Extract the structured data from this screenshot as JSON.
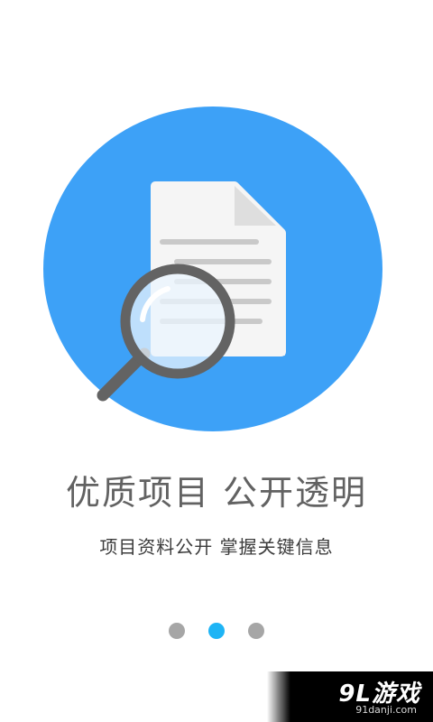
{
  "hero": {
    "illustration": "document-search-illustration",
    "circle_color": "#3da1f7"
  },
  "headline": "优质项目 公开透明",
  "subline": "项目资料公开  掌握关键信息",
  "pager": {
    "count": 3,
    "active_index": 1,
    "active_color": "#1eb4f5",
    "inactive_color": "#a6a6a6"
  },
  "watermark": {
    "logo": "9L游戏",
    "url": "91danji.com"
  },
  "colors": {
    "headline_text": "#626262",
    "subline_text": "#3c3c3c",
    "magnifier": "#636363"
  }
}
